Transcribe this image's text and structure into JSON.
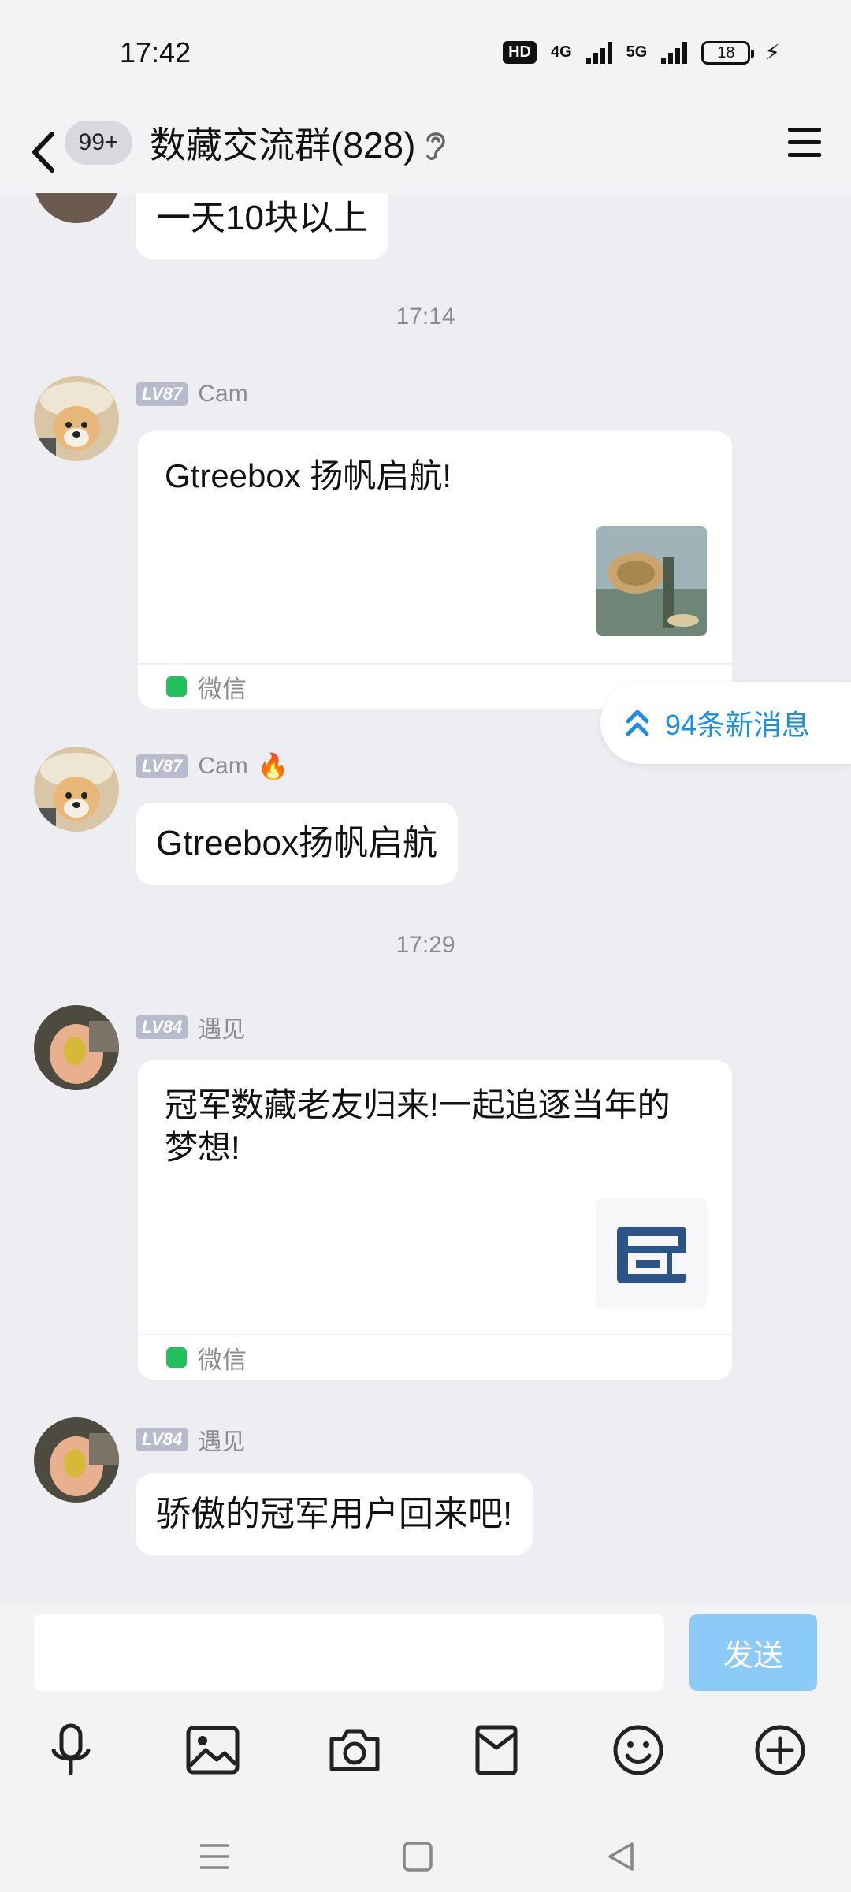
{
  "status_bar": {
    "time": "17:42",
    "hd": "HD",
    "net1": "4G",
    "net2": "5G",
    "battery": "18"
  },
  "header": {
    "unread_badge": "99+",
    "title": "数藏交流群(828)"
  },
  "messages": {
    "m0_text": "一天10块以上",
    "ts1": "17:14",
    "m1_level": "LV87",
    "m1_sender": "Cam",
    "m1_card_title": "Gtreebox 扬帆启航!",
    "m1_source": "微信",
    "m2_level": "LV87",
    "m2_sender": "Cam",
    "m2_text": "Gtreebox扬帆启航",
    "ts2": "17:29",
    "m3_level": "LV84",
    "m3_sender": "遇见",
    "m3_card_title": "冠军数藏老友归来!一起追逐当年的梦想!",
    "m3_source": "微信",
    "m4_level": "LV84",
    "m4_sender": "遇见",
    "m4_text": "骄傲的冠军用户回来吧!"
  },
  "new_messages_pill": "94条新消息",
  "input": {
    "placeholder": "",
    "send_label": "发送"
  },
  "toolbar_icons": [
    "microphone-icon",
    "image-icon",
    "camera-icon",
    "red-packet-icon",
    "emoji-icon",
    "plus-icon"
  ],
  "colors": {
    "accent": "#1a8fe3",
    "send_disabled": "#8ccaf7",
    "wechat_green": "#21c05a",
    "background": "#ededf2"
  }
}
